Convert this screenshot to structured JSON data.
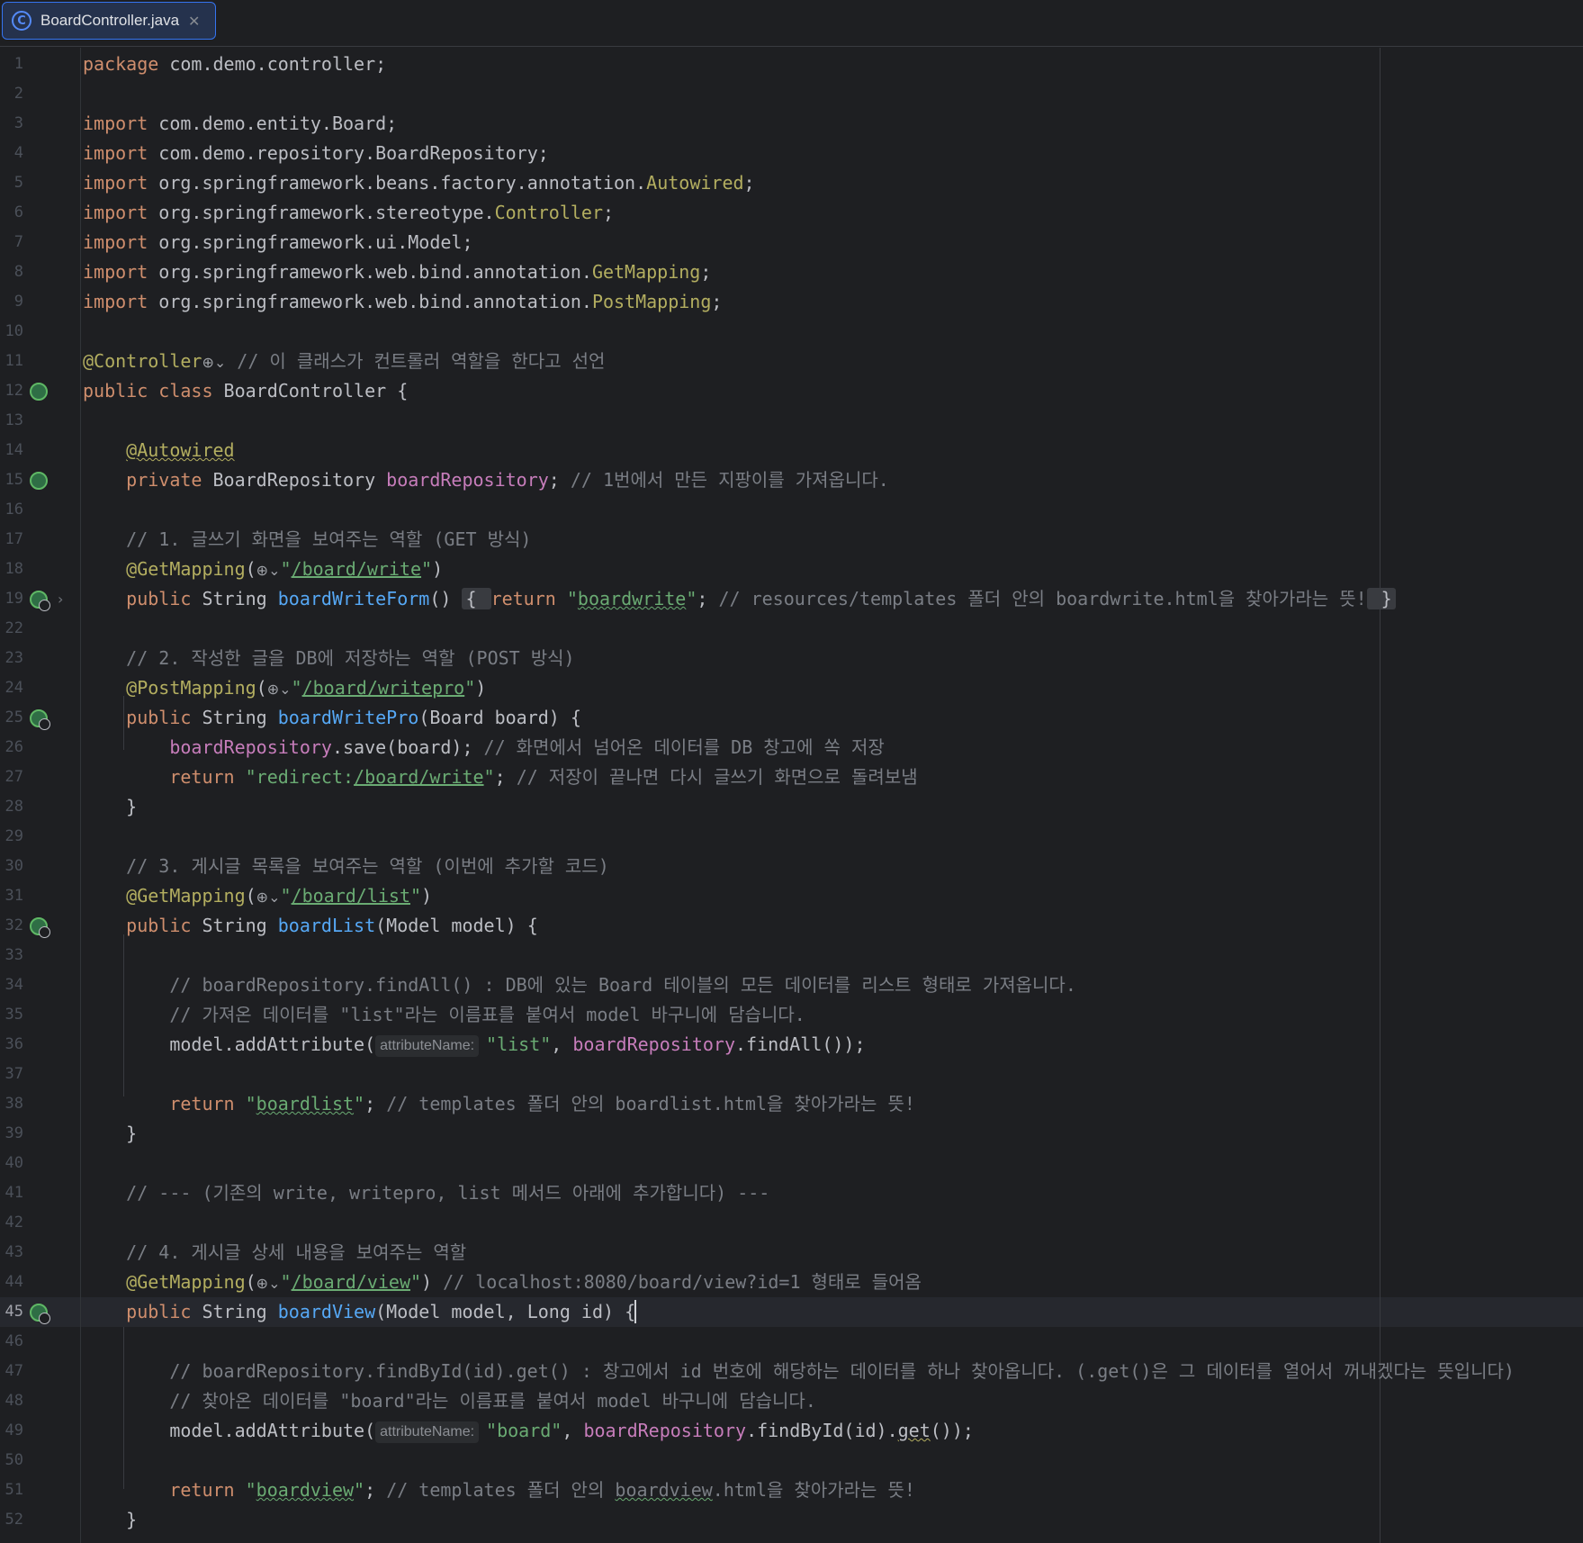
{
  "tab": {
    "title": "BoardController.java",
    "icon": "class-icon"
  },
  "lines": [
    {
      "n": "1",
      "segs": [
        [
          "kw",
          "package "
        ],
        [
          "plain",
          "com.demo.controller;"
        ]
      ]
    },
    {
      "n": "2",
      "segs": []
    },
    {
      "n": "3",
      "segs": [
        [
          "kw",
          "import "
        ],
        [
          "plain",
          "com.demo.entity.Board;"
        ]
      ]
    },
    {
      "n": "4",
      "segs": [
        [
          "kw",
          "import "
        ],
        [
          "plain",
          "com.demo.repository.BoardRepository;"
        ]
      ]
    },
    {
      "n": "5",
      "segs": [
        [
          "kw",
          "import "
        ],
        [
          "plain",
          "org.springframework.beans.factory.annotation."
        ],
        [
          "ann",
          "Autowired"
        ],
        [
          "plain",
          ";"
        ]
      ]
    },
    {
      "n": "6",
      "segs": [
        [
          "kw",
          "import "
        ],
        [
          "plain",
          "org.springframework.stereotype."
        ],
        [
          "ann",
          "Controller"
        ],
        [
          "plain",
          ";"
        ]
      ]
    },
    {
      "n": "7",
      "segs": [
        [
          "kw",
          "import "
        ],
        [
          "plain",
          "org.springframework.ui.Model;"
        ]
      ]
    },
    {
      "n": "8",
      "segs": [
        [
          "kw",
          "import "
        ],
        [
          "plain",
          "org.springframework.web.bind.annotation."
        ],
        [
          "ann",
          "GetMapping"
        ],
        [
          "plain",
          ";"
        ]
      ]
    },
    {
      "n": "9",
      "segs": [
        [
          "kw",
          "import "
        ],
        [
          "plain",
          "org.springframework.web.bind.annotation."
        ],
        [
          "ann",
          "PostMapping"
        ],
        [
          "plain",
          ";"
        ]
      ]
    },
    {
      "n": "10",
      "segs": []
    },
    {
      "n": "11",
      "segs": [
        [
          "ann",
          "@Controller"
        ],
        [
          "globe",
          "⊕⌄"
        ],
        [
          "cm",
          " // 이 클래스가 컨트롤러 역할을 한다고 선언"
        ]
      ]
    },
    {
      "n": "12",
      "icon": "bean",
      "segs": [
        [
          "kw",
          "public class "
        ],
        [
          "plain",
          "BoardController {"
        ]
      ]
    },
    {
      "n": "13",
      "segs": []
    },
    {
      "n": "14",
      "segs": [
        [
          "plain",
          "    "
        ],
        [
          "ann squig-plain",
          "@Autowired"
        ]
      ]
    },
    {
      "n": "15",
      "icon": "bean",
      "segs": [
        [
          "plain",
          "    "
        ],
        [
          "kw",
          "private "
        ],
        [
          "plain",
          "BoardRepository "
        ],
        [
          "fld",
          "boardRepository"
        ],
        [
          "plain",
          "; "
        ],
        [
          "cm",
          "// 1번에서 만든 지팡이를 가져옵니다."
        ]
      ]
    },
    {
      "n": "16",
      "segs": []
    },
    {
      "n": "17",
      "segs": [
        [
          "plain",
          "    "
        ],
        [
          "cm",
          "// 1. 글쓰기 화면을 보여주는 역할 (GET 방식)"
        ]
      ]
    },
    {
      "n": "18",
      "segs": [
        [
          "plain",
          "    "
        ],
        [
          "ann",
          "@GetMapping"
        ],
        [
          "plain",
          "("
        ],
        [
          "globe",
          "⊕⌄"
        ],
        [
          "str",
          "\""
        ],
        [
          "url",
          "/board/write"
        ],
        [
          "str",
          "\""
        ],
        [
          "plain",
          ")"
        ]
      ]
    },
    {
      "n": "19",
      "icon": "web",
      "fold": "›",
      "segs": [
        [
          "plain",
          "    "
        ],
        [
          "kw",
          "public "
        ],
        [
          "plain",
          "String "
        ],
        [
          "fn",
          "boardWriteForm"
        ],
        [
          "plain",
          "() "
        ],
        [
          "foldbox",
          "{ "
        ],
        [
          "kw",
          "return "
        ],
        [
          "str",
          "\""
        ],
        [
          "str squig",
          "boardwrite"
        ],
        [
          "str",
          "\""
        ],
        [
          "plain",
          "; "
        ],
        [
          "cm",
          "// resources/templates 폴더 안의 boardwrite.html을 찾아가라는 뜻!"
        ],
        [
          "foldbox",
          " }"
        ]
      ]
    },
    {
      "n": "22",
      "segs": []
    },
    {
      "n": "23",
      "segs": [
        [
          "plain",
          "    "
        ],
        [
          "cm",
          "// 2. 작성한 글을 DB에 저장하는 역할 (POST 방식)"
        ]
      ]
    },
    {
      "n": "24",
      "segs": [
        [
          "plain",
          "    "
        ],
        [
          "ann",
          "@PostMapping"
        ],
        [
          "plain",
          "("
        ],
        [
          "globe",
          "⊕⌄"
        ],
        [
          "str",
          "\""
        ],
        [
          "url",
          "/board/writepro"
        ],
        [
          "str",
          "\""
        ],
        [
          "plain",
          ")"
        ]
      ]
    },
    {
      "n": "25",
      "icon": "web",
      "segs": [
        [
          "plain",
          "    "
        ],
        [
          "kw",
          "public "
        ],
        [
          "plain",
          "String "
        ],
        [
          "fn",
          "boardWritePro"
        ],
        [
          "plain",
          "(Board board) {"
        ]
      ]
    },
    {
      "n": "26",
      "segs": [
        [
          "plain",
          "        "
        ],
        [
          "fld",
          "boardRepository"
        ],
        [
          "plain",
          ".save(board); "
        ],
        [
          "cm",
          "// 화면에서 넘어온 데이터를 DB 창고에 쏙 저장"
        ]
      ]
    },
    {
      "n": "27",
      "segs": [
        [
          "plain",
          "        "
        ],
        [
          "kw",
          "return "
        ],
        [
          "str",
          "\"redirect:"
        ],
        [
          "url",
          "/board/write"
        ],
        [
          "str",
          "\""
        ],
        [
          "plain",
          "; "
        ],
        [
          "cm",
          "// 저장이 끝나면 다시 글쓰기 화면으로 돌려보냄"
        ]
      ]
    },
    {
      "n": "28",
      "segs": [
        [
          "plain",
          "    }"
        ]
      ]
    },
    {
      "n": "29",
      "segs": []
    },
    {
      "n": "30",
      "segs": [
        [
          "plain",
          "    "
        ],
        [
          "cm",
          "// 3. 게시글 목록을 보여주는 역할 (이번에 추가할 코드)"
        ]
      ]
    },
    {
      "n": "31",
      "segs": [
        [
          "plain",
          "    "
        ],
        [
          "ann",
          "@GetMapping"
        ],
        [
          "plain",
          "("
        ],
        [
          "globe",
          "⊕⌄"
        ],
        [
          "str",
          "\""
        ],
        [
          "url",
          "/board/list"
        ],
        [
          "str",
          "\""
        ],
        [
          "plain",
          ")"
        ]
      ]
    },
    {
      "n": "32",
      "icon": "web",
      "segs": [
        [
          "plain",
          "    "
        ],
        [
          "kw",
          "public "
        ],
        [
          "plain",
          "String "
        ],
        [
          "fn",
          "boardList"
        ],
        [
          "plain",
          "(Model model) {"
        ]
      ]
    },
    {
      "n": "33",
      "segs": []
    },
    {
      "n": "34",
      "segs": [
        [
          "plain",
          "        "
        ],
        [
          "cm",
          "// boardRepository.findAll() : DB에 있는 Board 테이블의 모든 데이터를 리스트 형태로 가져옵니다."
        ]
      ]
    },
    {
      "n": "35",
      "segs": [
        [
          "plain",
          "        "
        ],
        [
          "cm",
          "// 가져온 데이터를 \"list\"라는 이름표를 붙여서 model 바구니에 담습니다."
        ]
      ]
    },
    {
      "n": "36",
      "segs": [
        [
          "plain",
          "        model.addAttribute("
        ],
        [
          "hint",
          "attributeName:"
        ],
        [
          "str",
          "\"list\""
        ],
        [
          "plain",
          ", "
        ],
        [
          "fld",
          "boardRepository"
        ],
        [
          "plain",
          ".findAll());"
        ]
      ]
    },
    {
      "n": "37",
      "segs": []
    },
    {
      "n": "38",
      "segs": [
        [
          "plain",
          "        "
        ],
        [
          "kw",
          "return "
        ],
        [
          "str",
          "\""
        ],
        [
          "str squig",
          "boardlist"
        ],
        [
          "str",
          "\""
        ],
        [
          "plain",
          "; "
        ],
        [
          "cm",
          "// templates 폴더 안의 boardlist.html을 찾아가라는 뜻!"
        ]
      ]
    },
    {
      "n": "39",
      "segs": [
        [
          "plain",
          "    }"
        ]
      ]
    },
    {
      "n": "40",
      "segs": []
    },
    {
      "n": "41",
      "segs": [
        [
          "plain",
          "    "
        ],
        [
          "cm",
          "// --- (기존의 write, writepro, list 메서드 아래에 추가합니다) ---"
        ]
      ]
    },
    {
      "n": "42",
      "segs": []
    },
    {
      "n": "43",
      "segs": [
        [
          "plain",
          "    "
        ],
        [
          "cm",
          "// 4. 게시글 상세 내용을 보여주는 역할"
        ]
      ]
    },
    {
      "n": "44",
      "segs": [
        [
          "plain",
          "    "
        ],
        [
          "ann",
          "@GetMapping"
        ],
        [
          "plain",
          "("
        ],
        [
          "globe",
          "⊕⌄"
        ],
        [
          "str",
          "\""
        ],
        [
          "url",
          "/board/view"
        ],
        [
          "str",
          "\""
        ],
        [
          "plain",
          ") "
        ],
        [
          "cm",
          "// localhost:8080/board/view?id=1 형태로 들어옴"
        ]
      ]
    },
    {
      "n": "45",
      "icon": "web",
      "active": true,
      "segs": [
        [
          "plain",
          "    "
        ],
        [
          "kw",
          "public "
        ],
        [
          "plain",
          "String "
        ],
        [
          "fn",
          "boardView"
        ],
        [
          "plain",
          "(Model model, Long id) {"
        ],
        [
          "cursor",
          ""
        ]
      ]
    },
    {
      "n": "46",
      "segs": []
    },
    {
      "n": "47",
      "segs": [
        [
          "plain",
          "        "
        ],
        [
          "cm",
          "// boardRepository.findById(id).get() : 창고에서 id 번호에 해당하는 데이터를 하나 찾아옵니다. (.get()은 그 데이터를 열어서 꺼내겠다는 뜻입니다)"
        ]
      ]
    },
    {
      "n": "48",
      "segs": [
        [
          "plain",
          "        "
        ],
        [
          "cm",
          "// 찾아온 데이터를 \"board\"라는 이름표를 붙여서 model 바구니에 담습니다."
        ]
      ]
    },
    {
      "n": "49",
      "segs": [
        [
          "plain",
          "        model.addAttribute("
        ],
        [
          "hint",
          "attributeName:"
        ],
        [
          "str",
          "\"board\""
        ],
        [
          "plain",
          ", "
        ],
        [
          "fld",
          "boardRepository"
        ],
        [
          "plain",
          ".findById(id)."
        ],
        [
          "plain squig-plain",
          "get"
        ],
        [
          "plain",
          "());"
        ]
      ]
    },
    {
      "n": "50",
      "segs": []
    },
    {
      "n": "51",
      "segs": [
        [
          "plain",
          "        "
        ],
        [
          "kw",
          "return "
        ],
        [
          "str",
          "\""
        ],
        [
          "str squig",
          "boardview"
        ],
        [
          "str",
          "\""
        ],
        [
          "plain",
          "; "
        ],
        [
          "cm",
          "// templates 폴더 안의 "
        ],
        [
          "cm squig",
          "boardview"
        ],
        [
          "cm",
          ".html을 찾아가라는 뜻!"
        ]
      ]
    },
    {
      "n": "52",
      "segs": [
        [
          "plain",
          "    }"
        ]
      ]
    }
  ]
}
